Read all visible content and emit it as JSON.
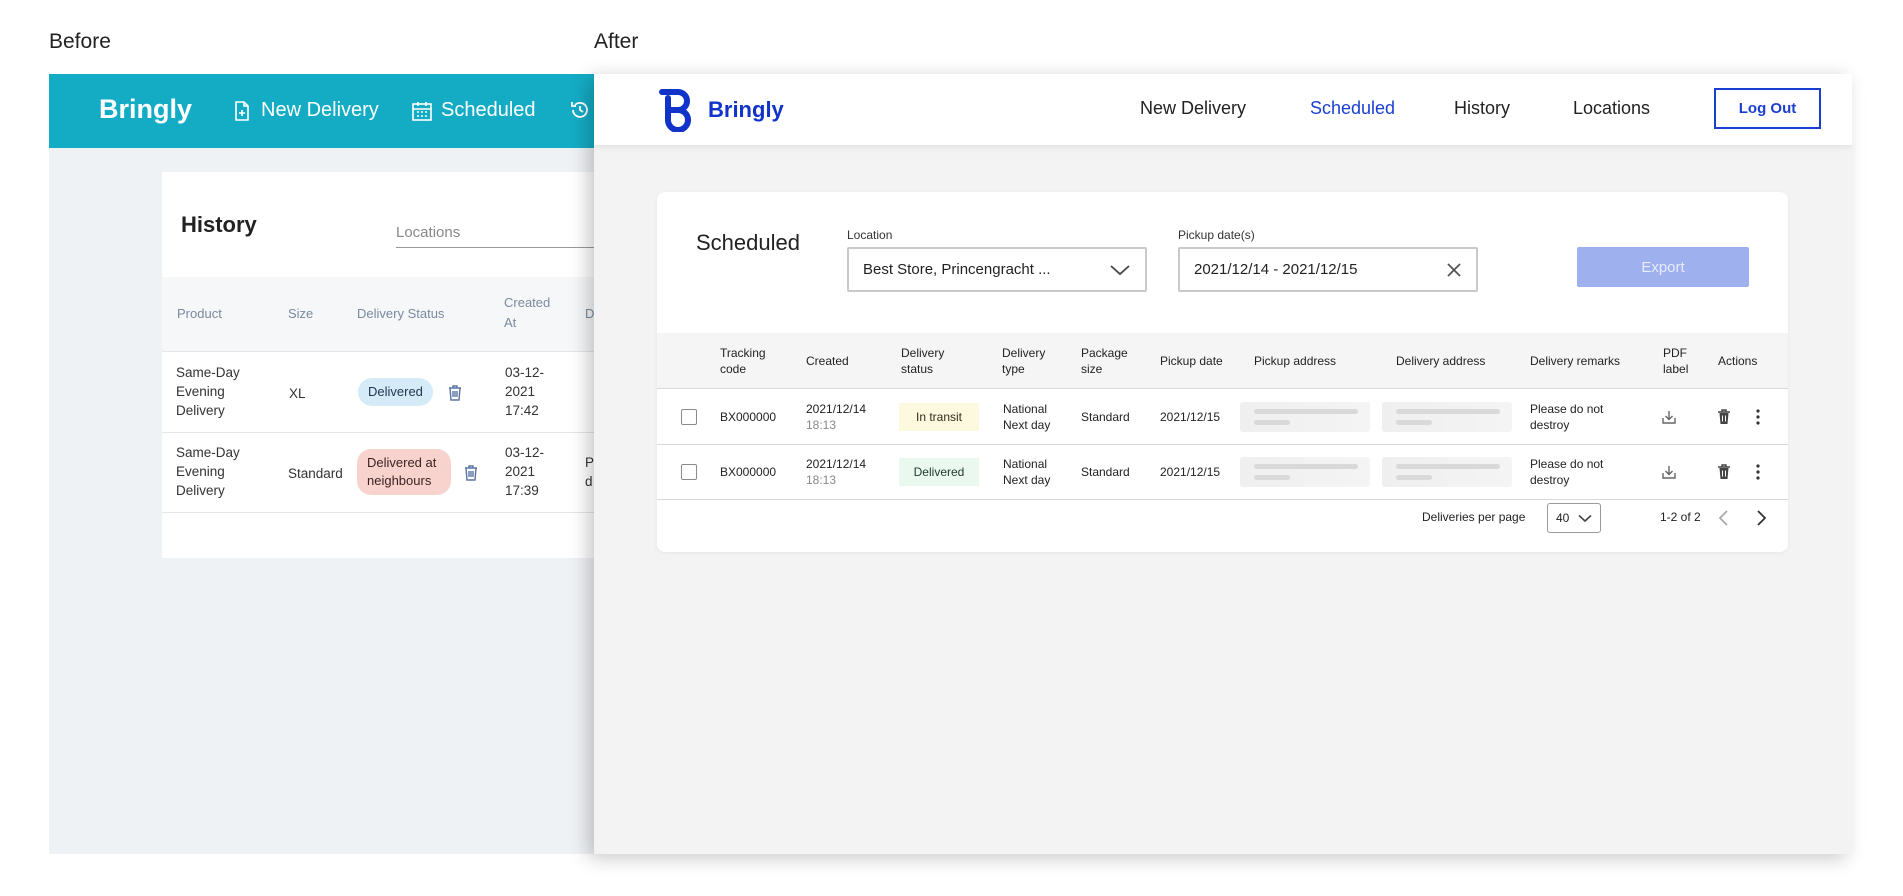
{
  "captions": {
    "before": "Before",
    "after": "After"
  },
  "before": {
    "brand": "Bringly",
    "nav": [
      {
        "label": "New Delivery",
        "icon": "new-document-icon"
      },
      {
        "label": "Scheduled",
        "icon": "calendar-icon"
      },
      {
        "label": "",
        "icon": "history-clock-icon"
      }
    ],
    "title": "History",
    "locations_placeholder": "Locations",
    "columns": [
      "Product",
      "Size",
      "Delivery Status",
      "Created At",
      "D"
    ],
    "rows": [
      {
        "product": "Same-Day Evening Delivery",
        "size": "XL",
        "status": "Delivered",
        "created": "03-12-2021 17:42",
        "extra": ""
      },
      {
        "product": "Same-Day Evening Delivery",
        "size": "Standard",
        "status": "Delivered at neighbours",
        "created": "03-12-2021 17:39",
        "extra": "P d"
      }
    ],
    "colors": {
      "header": "#14acc5",
      "badge_blue": "#d6ebf8",
      "badge_red": "#f8d3cd"
    }
  },
  "after": {
    "brand": "Bringly",
    "nav": [
      "New Delivery",
      "Scheduled",
      "History",
      "Locations"
    ],
    "active_nav": "Scheduled",
    "logout": "Log Out",
    "title": "Scheduled",
    "location_label": "Location",
    "location_value": "Best Store, Princengracht ...",
    "pickup_label": "Pickup date(s)",
    "pickup_value": "2021/12/14 - 2021/12/15",
    "export": "Export",
    "columns": {
      "tracking": "Tracking code",
      "created": "Created",
      "status": "Delivery status",
      "type": "Delivery type",
      "size": "Package size",
      "pickup_date": "Pickup date",
      "pickup_address": "Pickup address",
      "delivery_address": "Delivery address",
      "remarks": "Delivery remarks",
      "pdf": "PDF label",
      "actions": "Actions"
    },
    "rows": [
      {
        "tracking": "BX000000",
        "created_date": "2021/12/14",
        "created_time": "18:13",
        "status": "In transit",
        "type": "National Next day",
        "size": "Standard",
        "pickup_date": "2021/12/15",
        "remarks": "Please do not destroy"
      },
      {
        "tracking": "BX000000",
        "created_date": "2021/12/14",
        "created_time": "18:13",
        "status": "Delivered",
        "type": "National Next day",
        "size": "Standard",
        "pickup_date": "2021/12/15",
        "remarks": "Please do not destroy"
      }
    ],
    "per_page_label": "Deliveries per page",
    "per_page_value": "40",
    "range": "1-2 of 2",
    "colors": {
      "accent": "#1a3fd0",
      "brand": "#1133c9",
      "in_transit_bg": "#fdf9df",
      "delivered_bg": "#eaf8ef",
      "export_bg": "#9fb0ee"
    }
  }
}
